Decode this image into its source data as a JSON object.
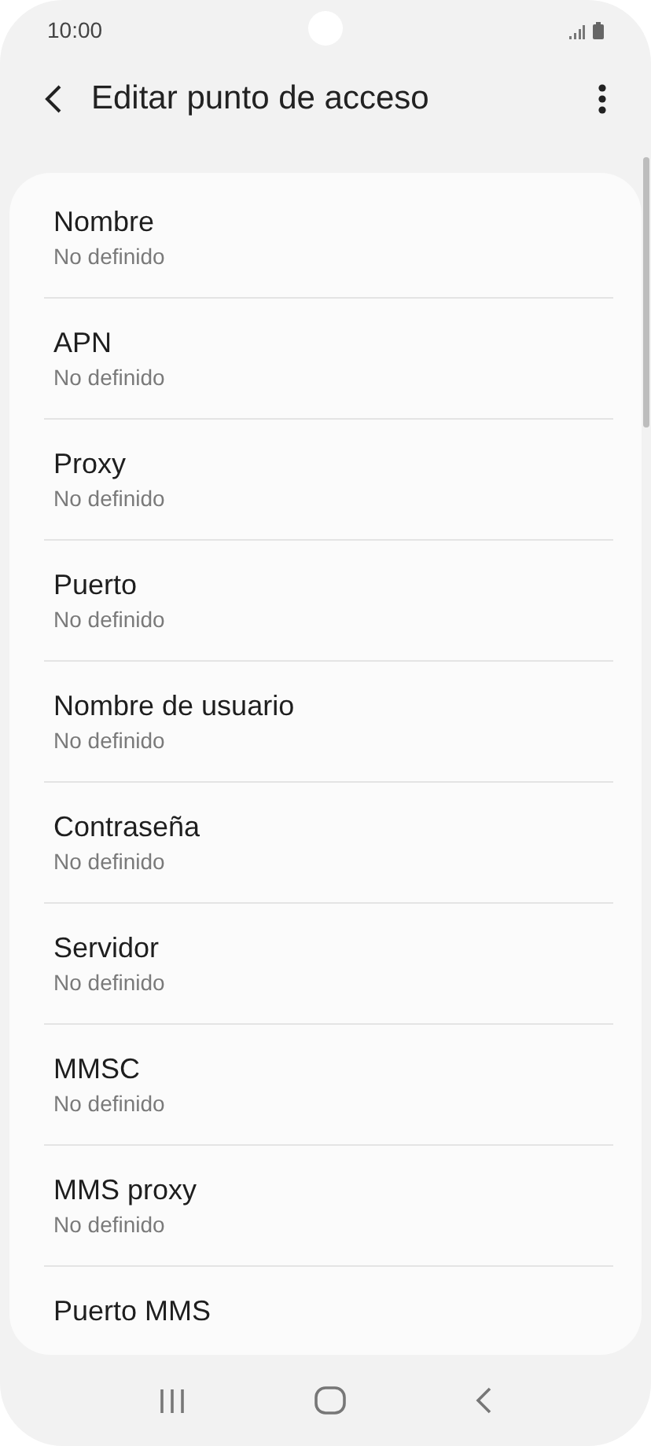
{
  "status_bar": {
    "time": "10:00"
  },
  "header": {
    "title": "Editar punto de acceso"
  },
  "items": [
    {
      "title": "Nombre",
      "value": "No definido"
    },
    {
      "title": "APN",
      "value": "No definido"
    },
    {
      "title": "Proxy",
      "value": "No definido"
    },
    {
      "title": "Puerto",
      "value": "No definido"
    },
    {
      "title": "Nombre de usuario",
      "value": "No definido"
    },
    {
      "title": "Contraseña",
      "value": "No definido"
    },
    {
      "title": "Servidor",
      "value": "No definido"
    },
    {
      "title": "MMSC",
      "value": "No definido"
    },
    {
      "title": "MMS proxy",
      "value": "No definido"
    },
    {
      "title": "Puerto MMS"
    }
  ]
}
